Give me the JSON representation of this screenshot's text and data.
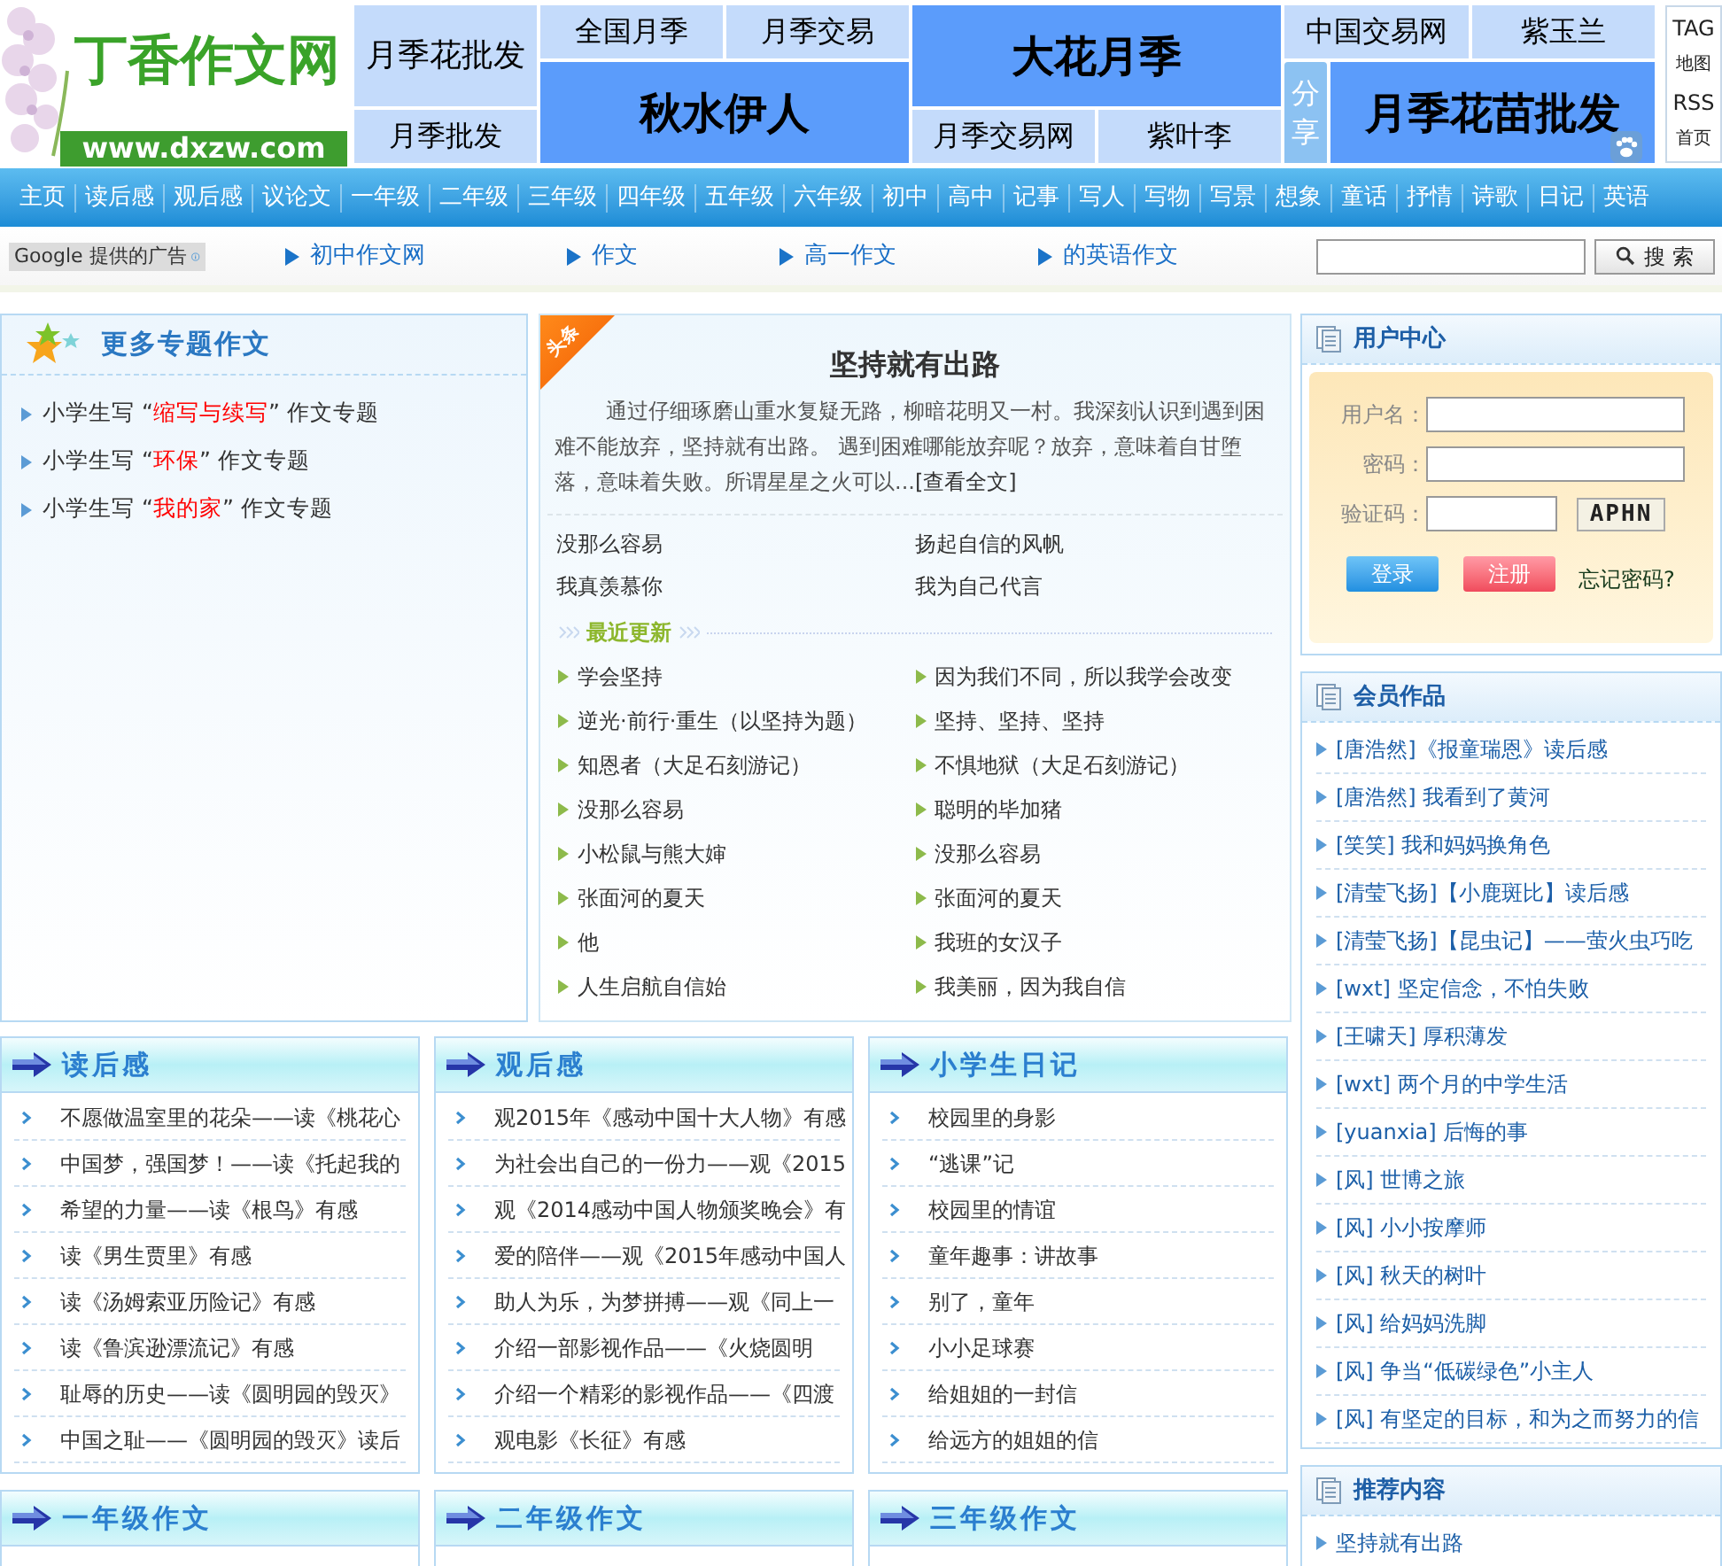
{
  "logo": {
    "title": "丁香作文网",
    "url": "www.dxzw.com"
  },
  "ad_columns": [
    {
      "rows": [
        {
          "kind": "tall",
          "cells": [
            {
              "text": "月季花批发",
              "kind": "light"
            }
          ]
        },
        {
          "kind": "short",
          "cells": [
            {
              "text": "月季批发",
              "kind": "light"
            }
          ]
        }
      ]
    },
    {
      "rows": [
        {
          "kind": "short",
          "cells": [
            {
              "text": "全国月季",
              "kind": "light"
            },
            {
              "text": "月季交易",
              "kind": "light"
            }
          ]
        },
        {
          "kind": "tall",
          "cells": [
            {
              "text": "秋水伊人",
              "kind": "strong"
            }
          ]
        }
      ]
    },
    {
      "rows": [
        {
          "kind": "tall",
          "cells": [
            {
              "text": "大花月季",
              "kind": "strong"
            }
          ]
        },
        {
          "kind": "short",
          "cells": [
            {
              "text": "月季交易网",
              "kind": "light"
            },
            {
              "text": "紫叶李",
              "kind": "light"
            }
          ]
        }
      ]
    },
    {
      "rows": [
        {
          "kind": "short",
          "cells": [
            {
              "text": "中国交易网",
              "kind": "light"
            },
            {
              "text": "紫玉兰",
              "kind": "light"
            }
          ]
        },
        {
          "kind": "tall",
          "cells": [
            {
              "text": "月季花苗批发",
              "kind": "strong"
            }
          ]
        }
      ]
    }
  ],
  "share_tab": "分享",
  "tag_links": [
    "TAG",
    "地图",
    "RSS",
    "首页"
  ],
  "nav": [
    "主页",
    "读后感",
    "观后感",
    "议论文",
    "一年级",
    "二年级",
    "三年级",
    "四年级",
    "五年级",
    "六年级",
    "初中",
    "高中",
    "记事",
    "写人",
    "写物",
    "写景",
    "想象",
    "童话",
    "抒情",
    "诗歌",
    "日记",
    "英语"
  ],
  "ad_bar": {
    "badge": "Google 提供的广告",
    "links": [
      "初中作文网",
      "作文",
      "高一作文",
      "的英语作文"
    ],
    "search_button": "搜 索"
  },
  "topics": {
    "title": "更多专题作文",
    "items": [
      {
        "prefix": "小学生写 “",
        "highlight": "缩写与续写",
        "suffix": "” 作文专题"
      },
      {
        "prefix": "小学生写 “",
        "highlight": "环保",
        "suffix": "” 作文专题"
      },
      {
        "prefix": "小学生写 “",
        "highlight": "我的家",
        "suffix": "” 作文专题"
      }
    ]
  },
  "headline": {
    "ribbon": "头条",
    "title": "坚持就有出路",
    "body": "通过仔细琢磨山重水复疑无路，柳暗花明又一村。我深刻认识到遇到困难不能放弃，坚持就有出路。 遇到困难哪能放弃呢？放弃，意味着自甘堕落，意味着失败。所谓星星之火可以...",
    "more": "[查看全文]",
    "featured": [
      "没那么容易",
      "扬起自信的风帆",
      "我真羡慕你",
      "我为自己代言"
    ],
    "recent_title": "最近更新",
    "recent": [
      "学会坚持",
      "因为我们不同，所以我学会改变",
      "逆光·前行·重生（以坚持为题）",
      "坚持、坚持、坚持",
      "知恩者（大足石刻游记）",
      "不惧地狱（大足石刻游记）",
      "没那么容易",
      "聪明的毕加猪",
      "小松鼠与熊大婶",
      "没那么容易",
      "张面河的夏天",
      "张面河的夏天",
      "他",
      "我班的女汉子",
      "人生启航自信始",
      "我美丽，因为我自信"
    ]
  },
  "user_center": {
    "title": "用户中心",
    "username_label": "用户名：",
    "password_label": "密码：",
    "captcha_label": "验证码：",
    "captcha": "APHN",
    "login": "登录",
    "register": "注册",
    "forgot": "忘记密码?"
  },
  "member_works": {
    "title": "会员作品",
    "items": [
      "[唐浩然]《报童瑞恩》读后感",
      "[唐浩然] 我看到了黄河",
      "[笑笑] 我和妈妈换角色",
      "[清莹飞扬]【小鹿斑比】读后感",
      "[清莹飞扬]【昆虫记】——萤火虫巧吃",
      "[wxt] 坚定信念，不怕失败",
      "[王啸天] 厚积薄发",
      "[wxt] 两个月的中学生活",
      "[yuanxia] 后悔的事",
      "[风] 世博之旅",
      "[风] 小小按摩师",
      "[风] 秋天的树叶",
      "[风] 给妈妈洗脚",
      "[风] 争当“低碳绿色”小主人",
      "[风] 有坚定的目标，和为之而努力的信"
    ]
  },
  "recommended": {
    "title": "推荐内容",
    "items": [
      "坚持就有出路"
    ]
  },
  "sections": [
    {
      "title": "读后感",
      "items": [
        "不愿做温室里的花朵——读《桃花心",
        "中国梦，强国梦！——读《托起我的",
        "希望的力量——读《根鸟》有感",
        "读《男生贾里》有感",
        "读《汤姆索亚历险记》有感",
        "读《鲁滨逊漂流记》有感",
        "耻辱的历史——读《圆明园的毁灭》",
        "中国之耻——《圆明园的毁灭》读后"
      ]
    },
    {
      "title": "观后感",
      "items": [
        "观2015年《感动中国十大人物》有感",
        "为社会出自己的一份力——观《2015",
        "观《2014感动中国人物颁奖晚会》有",
        "爱的陪伴——观《2015年感动中国人",
        "助人为乐，为梦拼搏——观《同上一",
        "介绍一部影视作品——《火烧圆明",
        "介绍一个精彩的影视作品——《四渡",
        "观电影《长征》有感"
      ]
    },
    {
      "title": "小学生日记",
      "items": [
        "校园里的身影",
        "“逃课”记",
        "校园里的情谊",
        "童年趣事：讲故事",
        "别了，童年",
        "小小足球赛",
        "给姐姐的一封信",
        "给远方的姐姐的信"
      ]
    }
  ],
  "grade_sections": [
    {
      "title": "一年级作文"
    },
    {
      "title": "二年级作文"
    },
    {
      "title": "三年级作文"
    }
  ]
}
